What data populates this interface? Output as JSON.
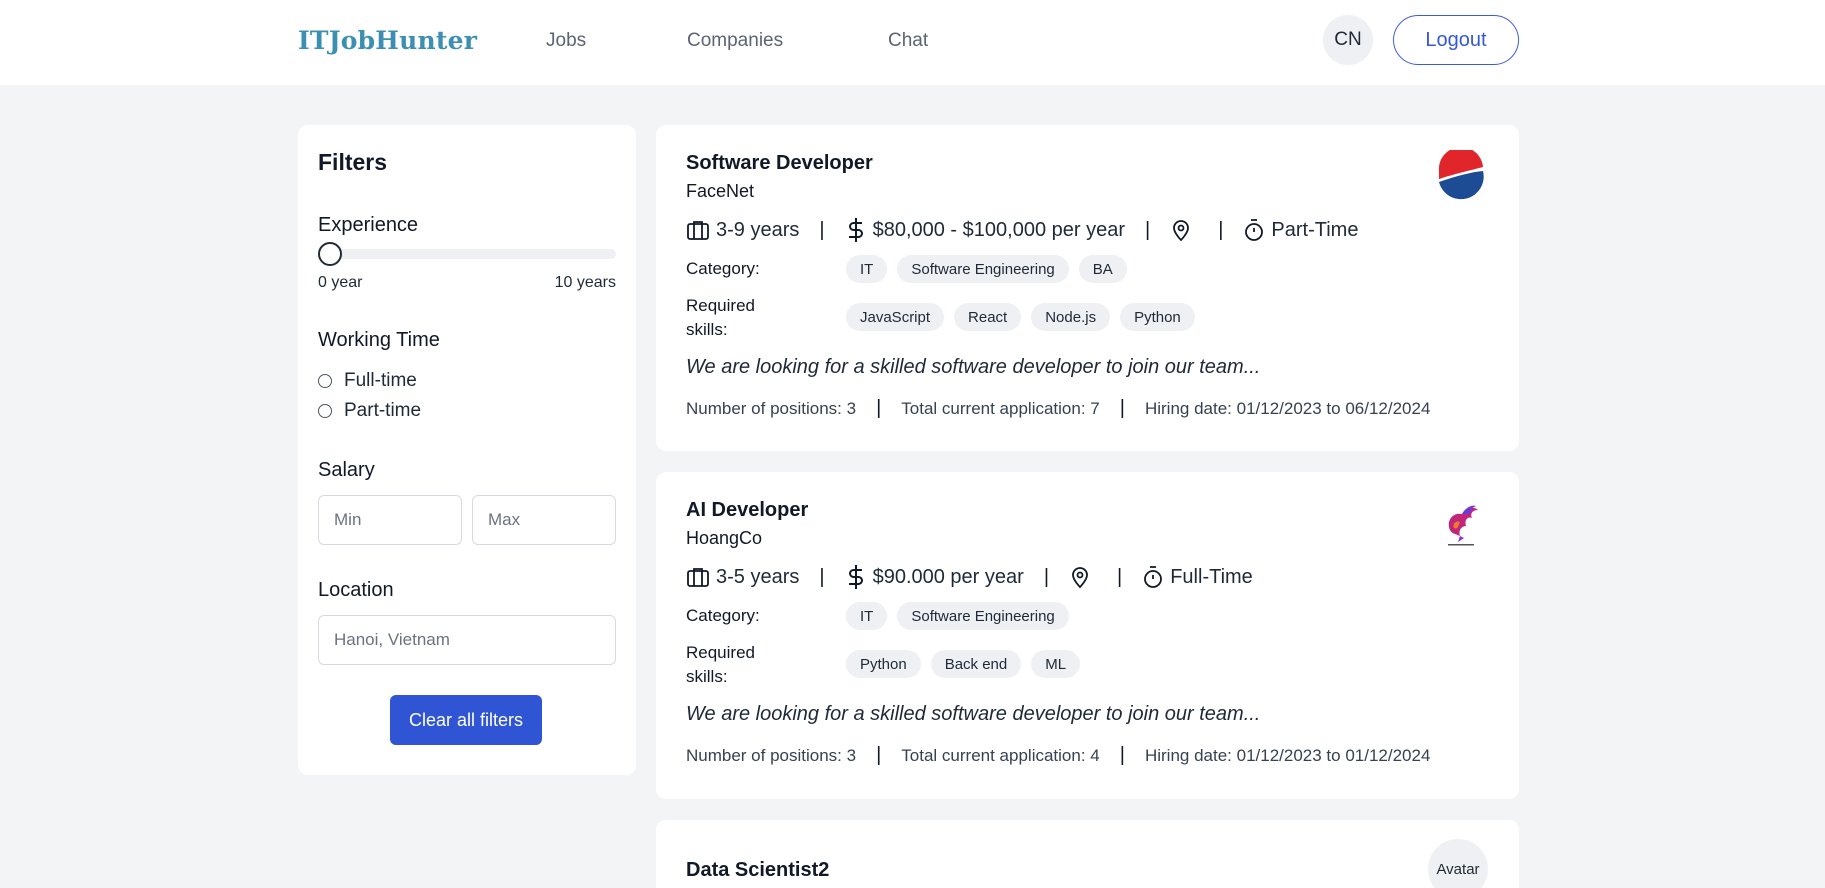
{
  "header": {
    "logo": "ITJobHunter",
    "nav": [
      "Jobs",
      "Companies",
      "Chat"
    ],
    "lang": "CN",
    "logout": "Logout"
  },
  "filters": {
    "title": "Filters",
    "experience": {
      "label": "Experience",
      "min_label": "0 year",
      "max_label": "10 years",
      "value": 0
    },
    "working_time": {
      "label": "Working Time",
      "options": [
        "Full-time",
        "Part-time"
      ]
    },
    "salary": {
      "label": "Salary",
      "min_placeholder": "Min",
      "max_placeholder": "Max"
    },
    "location": {
      "label": "Location",
      "placeholder": "Hanoi, Vietnam"
    },
    "clear": "Clear all filters"
  },
  "labels": {
    "category": "Category:",
    "skills_line1": "Required",
    "skills_line2": "skills:",
    "sep": "|"
  },
  "jobs": [
    {
      "title": "Software Developer",
      "company": "FaceNet",
      "experience": "3-9 years",
      "salary": "$80,000 - $100,000 per year",
      "time": "Part-Time",
      "categories": [
        "IT",
        "Software Engineering",
        "BA"
      ],
      "skills": [
        "JavaScript",
        "React",
        "Node.js",
        "Python"
      ],
      "description": "We are looking for a skilled software developer to join our team...",
      "positions": "Number of positions: 3",
      "applications": "Total current application: 7",
      "hiring": "Hiring date: 01/12/2023 to 06/12/2024",
      "logo": "pepsi-logo"
    },
    {
      "title": "AI Developer",
      "company": "HoangCo",
      "experience": "3-5 years",
      "salary": "$90.000 per year",
      "time": "Full-Time",
      "categories": [
        "IT",
        "Software Engineering"
      ],
      "skills": [
        "Python",
        "Back end",
        "ML"
      ],
      "description": "We are looking for a skilled software developer to join our team...",
      "positions": "Number of positions: 3",
      "applications": "Total current application: 4",
      "hiring": "Hiring date: 01/12/2023 to 01/12/2024",
      "logo": "bird-logo"
    },
    {
      "title": "Data Scientist2",
      "avatar": "Avatar"
    }
  ],
  "colors": {
    "accent": "#2f55d4",
    "logo": "#3b8fb3",
    "background": "#f3f4f6"
  }
}
